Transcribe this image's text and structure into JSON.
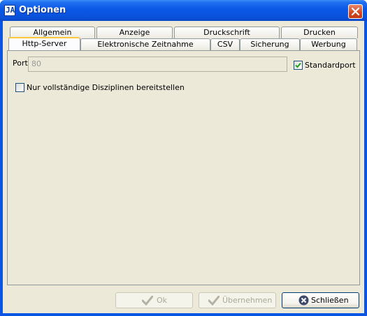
{
  "window": {
    "title": "Optionen",
    "app_icon_text": "JA"
  },
  "tabs_top": [
    {
      "label": "Allgemein"
    },
    {
      "label": "Anzeige"
    },
    {
      "label": "Druckschrift"
    },
    {
      "label": "Drucken"
    }
  ],
  "tabs_bottom": [
    {
      "label": "Http-Server",
      "selected": true
    },
    {
      "label": "Elektronische Zeitnahme"
    },
    {
      "label": "CSV"
    },
    {
      "label": "Sicherung"
    },
    {
      "label": "Werbung"
    }
  ],
  "http_server": {
    "port_label": "Port",
    "port_value": "80",
    "standard_port_label": "Standardport",
    "standard_port_checked": true,
    "complete_only_label": "Nur vollständige Disziplinen bereitstellen",
    "complete_only_checked": false
  },
  "buttons": {
    "ok": "Ok",
    "apply": "Übernehmen",
    "close": "Schließen"
  },
  "colors": {
    "titlebar": "#0a55e4",
    "tab_highlight": "#ffc83c",
    "check": "#21a121"
  }
}
